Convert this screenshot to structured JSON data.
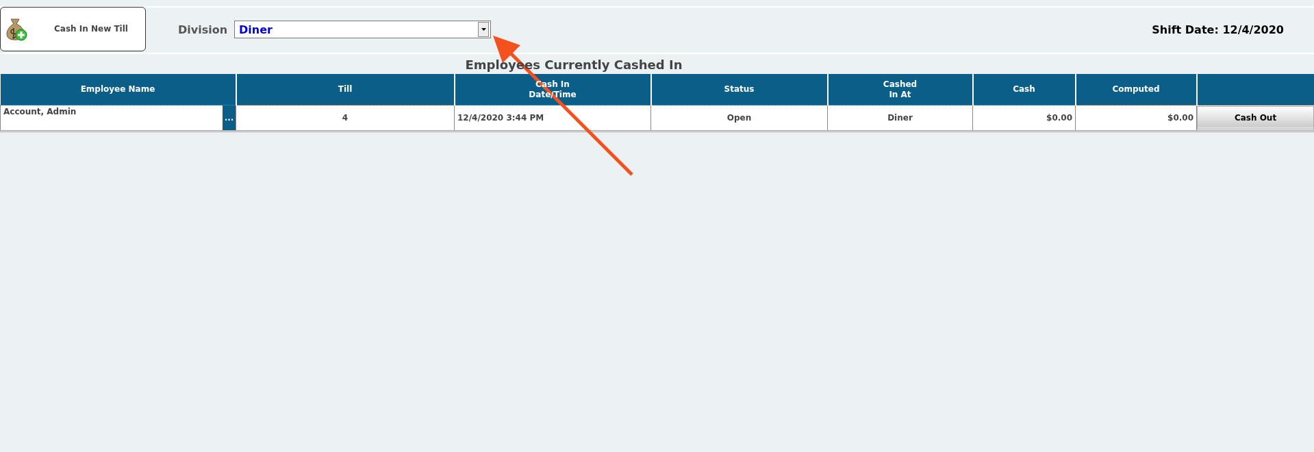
{
  "toolbar": {
    "cash_in_button": "Cash In New Till",
    "division_label": "Division",
    "division_value": "Diner",
    "shift_date": "Shift Date: 12/4/2020"
  },
  "table": {
    "title": "Employees Currently Cashed In",
    "columns": [
      {
        "label": "Employee Name"
      },
      {
        "label": "Till"
      },
      {
        "label": "Cash In\nDate/Time"
      },
      {
        "label": "Status"
      },
      {
        "label": "Cashed\nIn At"
      },
      {
        "label": "Cash"
      },
      {
        "label": "Computed"
      }
    ],
    "rows": [
      {
        "employee": "Account, Admin",
        "more": "...",
        "till": "4",
        "cash_in": "12/4/2020 3:44 PM",
        "status": "Open",
        "cashed_in_at": "Diner",
        "cash": "$0.00",
        "computed": "$0.00",
        "action": "Cash Out"
      }
    ]
  }
}
